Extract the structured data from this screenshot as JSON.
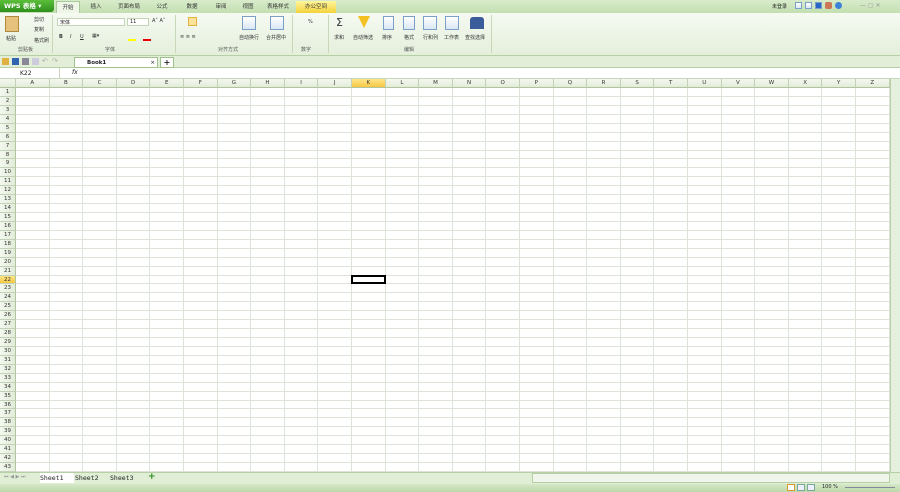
{
  "app": {
    "logo": "WPS 表格",
    "login": "未登录"
  },
  "tabs": [
    "开始",
    "插入",
    "页面布局",
    "公式",
    "数据",
    "审阅",
    "视图",
    "表格样式",
    "办公空间"
  ],
  "ribbon": {
    "clipboard": {
      "paste": "粘贴",
      "cut": "剪切",
      "copy": "复制",
      "format_painter": "格式刷",
      "group": "剪贴板"
    },
    "font": {
      "name": "宋体",
      "size": "11",
      "bold": "B",
      "italic": "I",
      "underline": "U",
      "group": "字体"
    },
    "align": {
      "wrap": "自动换行",
      "merge": "合并居中",
      "group": "对齐方式"
    },
    "number": {
      "percent": "%",
      "group": "数字"
    },
    "edit": {
      "sum": "求和",
      "filter": "自动筛选",
      "sort": "排序",
      "format": "格式",
      "rowcol": "行和列",
      "sheet": "工作表",
      "find": "查找选择",
      "group": "编辑"
    }
  },
  "document": {
    "tab": "Book1"
  },
  "formula": {
    "name_box": "K22",
    "fx": "fx",
    "value": ""
  },
  "grid": {
    "columns": [
      "A",
      "B",
      "C",
      "D",
      "E",
      "F",
      "G",
      "H",
      "I",
      "J",
      "K",
      "L",
      "M",
      "N",
      "O",
      "P",
      "Q",
      "R",
      "S",
      "T",
      "U",
      "V",
      "W",
      "X",
      "Y",
      "Z"
    ],
    "row_count": 43,
    "selected_col": "K",
    "selected_row": 22
  },
  "sheets": [
    "Sheet1",
    "Sheet2",
    "Sheet3"
  ],
  "status": {
    "zoom": "100 %"
  }
}
